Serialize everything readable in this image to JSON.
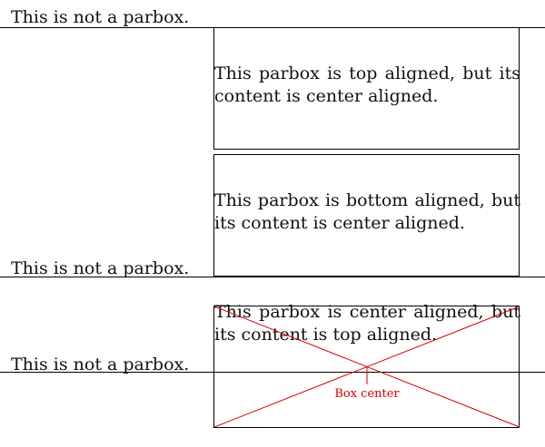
{
  "rows": [
    {
      "label": "This is not a parbox.",
      "parbox_text": "This parbox is top aligned, but its content is center aligned."
    },
    {
      "label": "This is not a parbox.",
      "parbox_text": "This parbox is bottom aligned, but its content is center aligned."
    },
    {
      "label": "This is not a parbox.",
      "parbox_text": "This parbox is center aligned, but its content is top aligned."
    }
  ],
  "annotation": {
    "box_center_label": "Box center",
    "color": "#d40000"
  }
}
